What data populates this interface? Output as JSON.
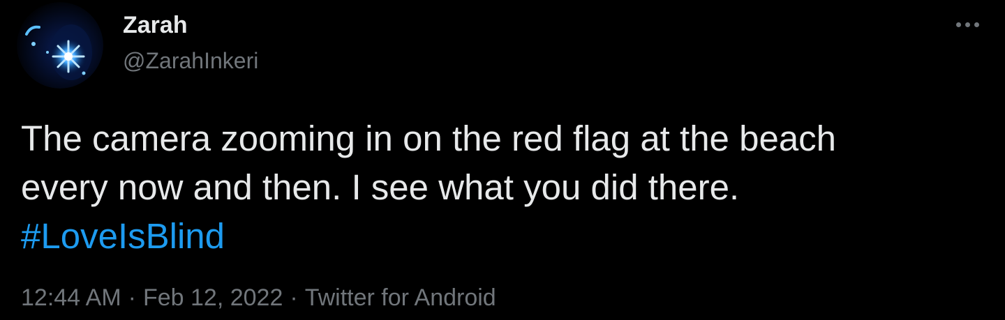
{
  "tweet": {
    "author": {
      "display_name": "Zarah",
      "handle": "@ZarahInkeri",
      "avatar_icon": "glowing-star-avatar"
    },
    "more_icon": "more-horizontal-icon",
    "text_lines": [
      "The camera zooming in on the red flag at the beach",
      "every now and then. I see what you did there."
    ],
    "hashtag": "#LoveIsBlind",
    "time": "12:44 AM",
    "separator": "·",
    "date": "Feb 12, 2022",
    "source": "Twitter for Android"
  },
  "colors": {
    "background": "#000000",
    "primary_text": "#e7e9ea",
    "secondary_text": "#71767b",
    "link": "#1d9bf0"
  }
}
